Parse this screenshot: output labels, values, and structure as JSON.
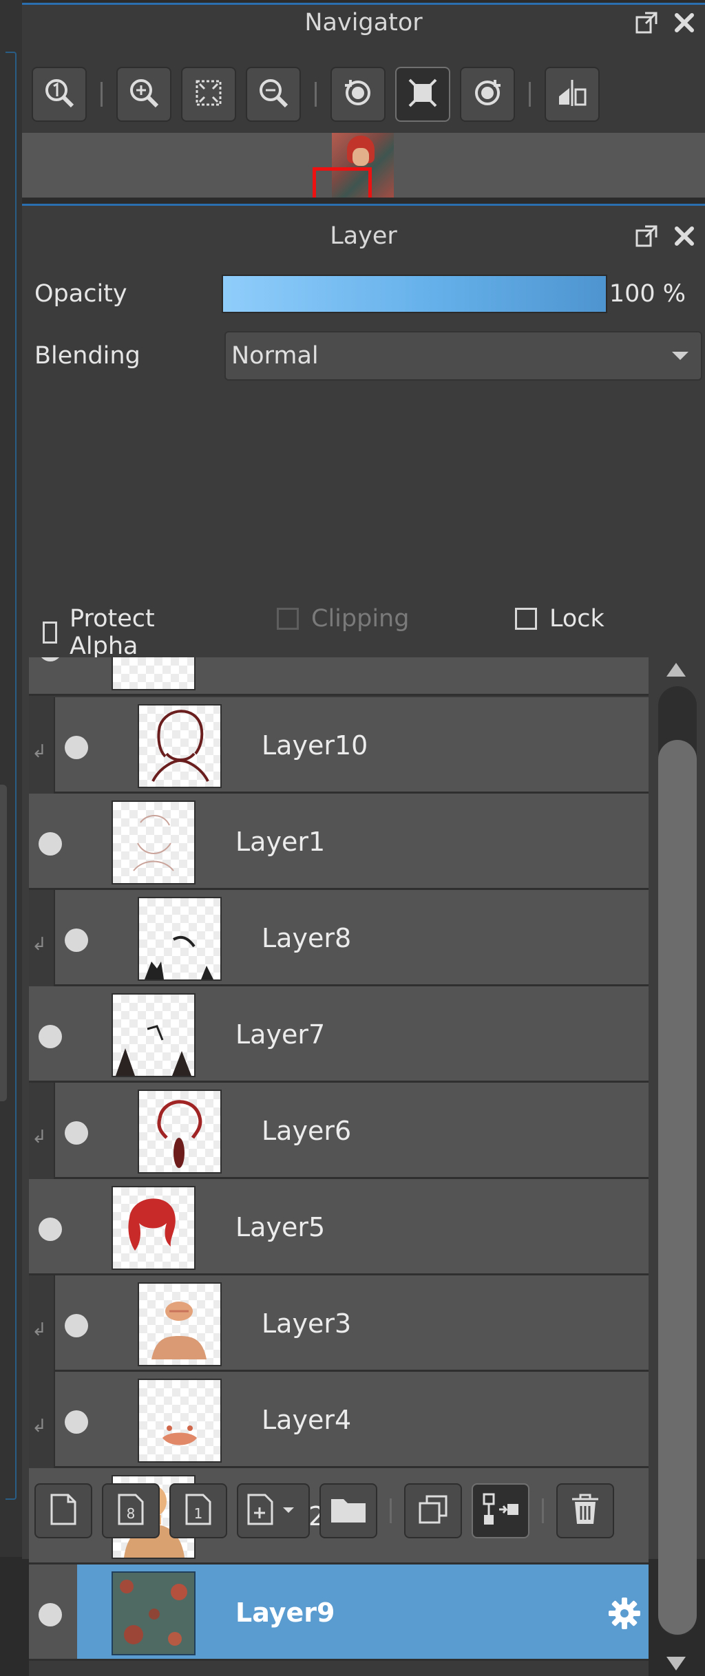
{
  "navigator": {
    "title": "Navigator",
    "toolbar": [
      "zoom-actual-icon",
      "zoom-in-icon",
      "fit-window-icon",
      "zoom-out-icon",
      "rotate-left-icon",
      "reset-view-icon",
      "rotate-right-icon",
      "flip-horizontal-icon"
    ]
  },
  "layer_panel": {
    "title": "Layer",
    "opacity_label": "Opacity",
    "opacity_value": "100 %",
    "opacity_fraction": 1.0,
    "blending_label": "Blending",
    "blending_value": "Normal",
    "protect_alpha_label": "Protect Alpha",
    "clipping_label": "Clipping",
    "lock_label": "Lock",
    "layers": [
      {
        "name": "Layer10",
        "clipped": true
      },
      {
        "name": "Layer1",
        "clipped": false
      },
      {
        "name": "Layer8",
        "clipped": true
      },
      {
        "name": "Layer7",
        "clipped": false
      },
      {
        "name": "Layer6",
        "clipped": true
      },
      {
        "name": "Layer5",
        "clipped": false
      },
      {
        "name": "Layer3",
        "clipped": true
      },
      {
        "name": "Layer4",
        "clipped": true
      },
      {
        "name": "Layer2",
        "clipped": false
      },
      {
        "name": "Layer9",
        "clipped": false,
        "selected": true
      }
    ],
    "colors": {
      "accent": "#5a9bd0",
      "row": "#545454"
    },
    "bottom_toolbar": [
      "new-layer-icon",
      "new-8bit-layer-icon",
      "new-1bit-layer-icon",
      "add-layer-menu-icon",
      "new-folder-icon",
      "duplicate-layer-icon",
      "merge-down-icon",
      "delete-layer-icon"
    ]
  }
}
